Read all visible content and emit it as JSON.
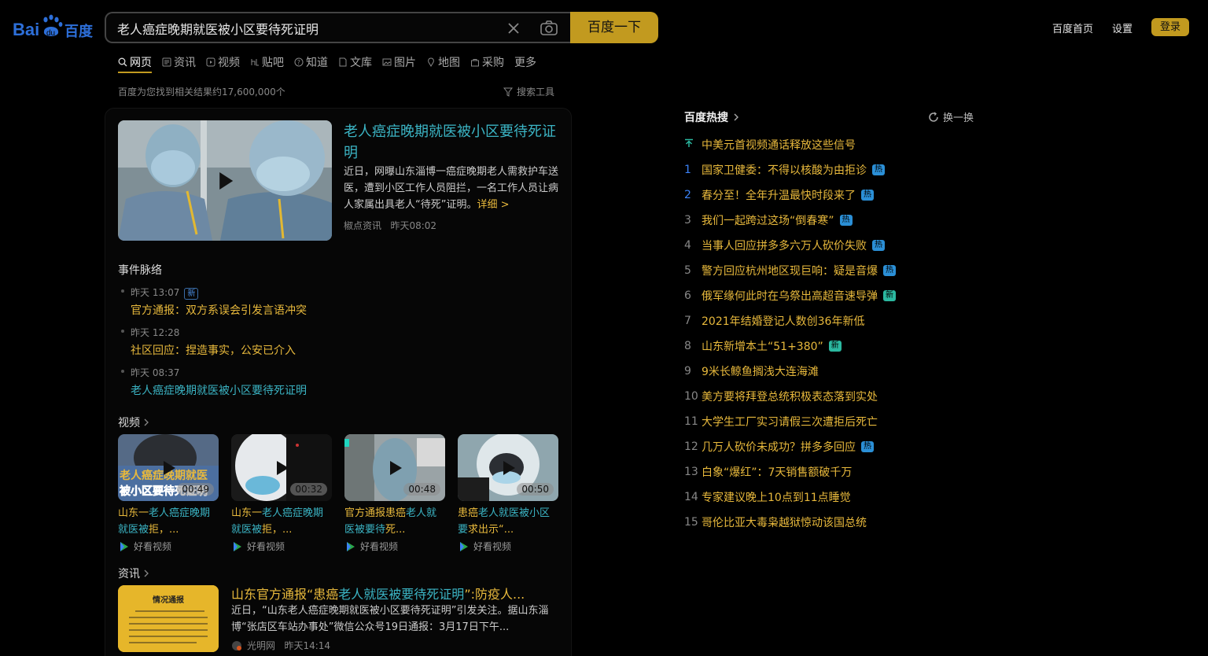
{
  "header": {
    "logo_text": "百度",
    "search_value": "老人癌症晚期就医被小区要待死证明",
    "search_button": "百度一下",
    "links": [
      "百度首页",
      "设置"
    ],
    "login": "登录",
    "accent": "#c29a1f"
  },
  "tabs": [
    {
      "label": "网页",
      "icon": "search-icon"
    },
    {
      "label": "资讯",
      "icon": "news-icon"
    },
    {
      "label": "视频",
      "icon": "video-icon"
    },
    {
      "label": "贴吧",
      "icon": "tieba-icon"
    },
    {
      "label": "知道",
      "icon": "question-icon"
    },
    {
      "label": "文库",
      "icon": "doc-icon"
    },
    {
      "label": "图片",
      "icon": "image-icon"
    },
    {
      "label": "地图",
      "icon": "map-icon"
    },
    {
      "label": "采购",
      "icon": "shop-icon"
    },
    {
      "label": "更多",
      "icon": ""
    }
  ],
  "result_count": "百度为您找到相关结果约17,600,000个",
  "search_tools": "搜索工具",
  "main_result": {
    "title": "老人癌症晚期就医被小区要待死证明",
    "desc": "近日，网曝山东淄博一癌症晚期老人需救护车送医，遭到小区工作人员阻拦，一名工作人员让病人家属出具老人“待死”证明。",
    "more": "详细 >",
    "source": "椒点资讯",
    "time": "昨天08:02"
  },
  "events": {
    "heading": "事件脉络",
    "items": [
      {
        "time": "昨天 13:07",
        "badge": "新",
        "text": "官方通报：双方系误会引发言语冲突"
      },
      {
        "time": "昨天 12:28",
        "badge": "",
        "text": "社区回应：捏造事实，公安已介入"
      },
      {
        "time": "昨天 08:37",
        "badge": "",
        "text": "老人癌症晚期就医被小区要待死证明"
      }
    ]
  },
  "videos": {
    "heading": "视频",
    "items": [
      {
        "duration": "00:49",
        "cap_pre": "山东一",
        "cap_hl": "老人癌症晚期就医被",
        "cap_post": "拒，...",
        "source": "好看视频",
        "overlay1": "老人癌症晚期就医",
        "overlay2": "被小区要待死证明"
      },
      {
        "duration": "00:32",
        "cap_pre": "山东一",
        "cap_hl": "老人癌症晚期就医被",
        "cap_post": "拒，...",
        "source": "好看视频"
      },
      {
        "duration": "00:48",
        "cap_pre": "官方通报患癌",
        "cap_hl": "老人就医被要待",
        "cap_post": "死...",
        "source": "好看视频"
      },
      {
        "duration": "00:50",
        "cap_pre": "患癌",
        "cap_hl": "老人就医被小区要",
        "cap_post": "求出示“...",
        "source": "好看视频"
      }
    ]
  },
  "news": {
    "heading": "资讯",
    "img_title": "情况通报",
    "title_pre": "山东官方通报“患癌",
    "title_hl": "老人就医被要待死证明",
    "title_post": "”:防疫人...",
    "desc": "近日，“山东老人癌症晚期就医被小区要待死证明”引发关注。据山东淄博“张店区车站办事处”微信公众号19日通报：3月17日下午...",
    "source": "光明网",
    "time": "昨天14:14"
  },
  "hot": {
    "title": "百度热搜",
    "refresh": "换一换",
    "items": [
      {
        "rank": "",
        "text": "中美元首视频通话释放这些信号",
        "tag": ""
      },
      {
        "rank": "1",
        "text": "国家卫健委：不得以核酸为由拒诊",
        "tag": "热"
      },
      {
        "rank": "2",
        "text": "春分至！全年升温最快时段来了",
        "tag": "热"
      },
      {
        "rank": "3",
        "text": "我们一起跨过这场“倒春寒”",
        "tag": "热"
      },
      {
        "rank": "4",
        "text": "当事人回应拼多多六万人砍价失败",
        "tag": "热"
      },
      {
        "rank": "5",
        "text": "警方回应杭州地区现巨响：疑是音爆",
        "tag": "热"
      },
      {
        "rank": "6",
        "text": "俄军缘何此时在乌祭出高超音速导弹",
        "tag": "新"
      },
      {
        "rank": "7",
        "text": "2021年结婚登记人数创36年新低",
        "tag": ""
      },
      {
        "rank": "8",
        "text": "山东新增本土“51+380”",
        "tag": "新"
      },
      {
        "rank": "9",
        "text": "9米长鲸鱼搁浅大连海滩",
        "tag": ""
      },
      {
        "rank": "10",
        "text": "美方要将拜登总统积极表态落到实处",
        "tag": ""
      },
      {
        "rank": "11",
        "text": "大学生工厂实习请假三次遭拒后死亡",
        "tag": ""
      },
      {
        "rank": "12",
        "text": "几万人砍价未成功？拼多多回应",
        "tag": "热"
      },
      {
        "rank": "13",
        "text": "白象“爆红”：7天销售额破千万",
        "tag": ""
      },
      {
        "rank": "14",
        "text": "专家建议晚上10点到11点睡觉",
        "tag": ""
      },
      {
        "rank": "15",
        "text": "哥伦比亚大毒枭越狱惊动该国总统",
        "tag": ""
      }
    ]
  }
}
